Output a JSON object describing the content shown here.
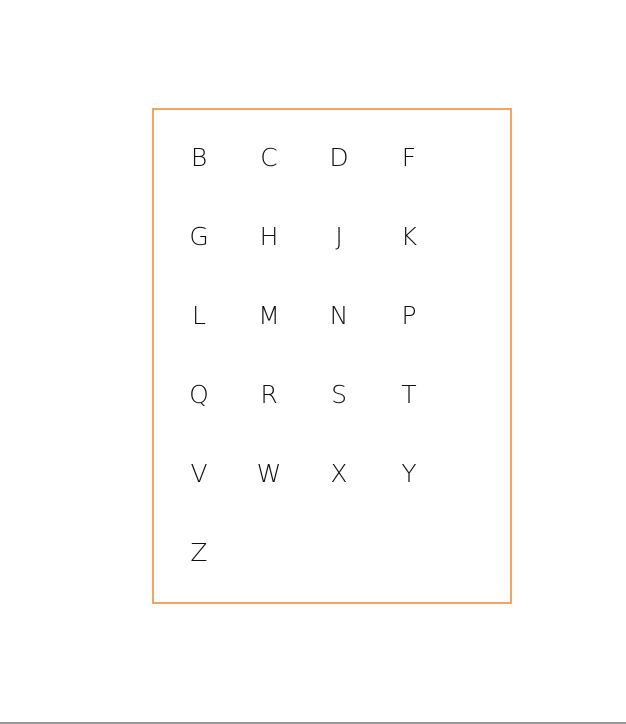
{
  "panel": {
    "border_color": "#f4a460",
    "letters": [
      "B",
      "C",
      "D",
      "F",
      "G",
      "H",
      "J",
      "K",
      "L",
      "M",
      "N",
      "P",
      "Q",
      "R",
      "S",
      "T",
      "V",
      "W",
      "X",
      "Y",
      "Z"
    ]
  }
}
